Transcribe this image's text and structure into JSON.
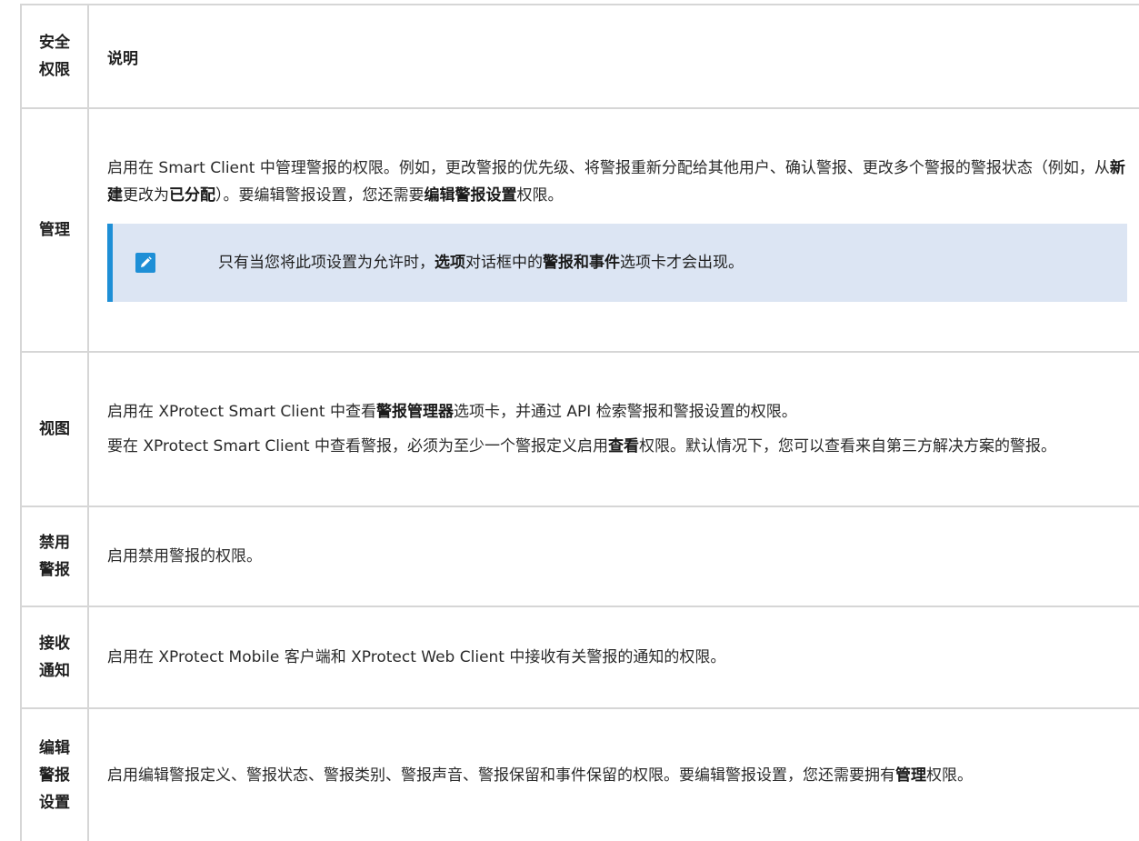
{
  "table": {
    "header": {
      "col1": "安全权限",
      "col1_lines": [
        "安全",
        "权限"
      ],
      "col2": "说明"
    },
    "rows": [
      {
        "name_lines": [
          "管理"
        ],
        "paragraphs": [
          [
            {
              "t": "启用在 Smart Client 中管理警报的权限。例如，更改警报的优先级、将警报重新分配给其他用户、确认警报、更改多个警报的警报状态（例如，从",
              "b": false
            },
            {
              "t": "新建",
              "b": true
            },
            {
              "t": "更改为",
              "b": false
            },
            {
              "t": "已分配",
              "b": true
            },
            {
              "t": "）。要编辑警报设置，您还需要",
              "b": false
            },
            {
              "t": "编辑警报设置",
              "b": true
            },
            {
              "t": "权限。",
              "b": false
            }
          ]
        ],
        "note": [
          {
            "t": "只有当您将此项设置为允许时，",
            "b": false
          },
          {
            "t": "选项",
            "b": true
          },
          {
            "t": "对话框中的",
            "b": false
          },
          {
            "t": "警报和事件",
            "b": true
          },
          {
            "t": "选项卡才会出现。",
            "b": false
          }
        ]
      },
      {
        "name_lines": [
          "视图"
        ],
        "paragraphs": [
          [
            {
              "t": "启用在 XProtect Smart Client 中查看",
              "b": false
            },
            {
              "t": "警报管理器",
              "b": true
            },
            {
              "t": "选项卡，并通过 API 检索警报和警报设置的权限。",
              "b": false
            }
          ],
          [
            {
              "t": "要在 XProtect Smart Client 中查看警报，必须为至少一个警报定义启用",
              "b": false
            },
            {
              "t": "查看",
              "b": true
            },
            {
              "t": "权限。默认情况下，您可以查看来自第三方解决方案的警报。",
              "b": false
            }
          ]
        ]
      },
      {
        "name_lines": [
          "禁用",
          "警报"
        ],
        "paragraphs": [
          [
            {
              "t": "启用禁用警报的权限。",
              "b": false
            }
          ]
        ]
      },
      {
        "name_lines": [
          "接收",
          "通知"
        ],
        "paragraphs": [
          [
            {
              "t": "启用在 XProtect Mobile 客户端和 XProtect Web Client 中接收有关警报的通知的权限。",
              "b": false
            }
          ]
        ]
      },
      {
        "name_lines": [
          "编辑",
          "警报",
          "设置"
        ],
        "paragraphs": [
          [
            {
              "t": "启用编辑警报定义、警报状态、警报类别、警报声音、警报保留和事件保留的权限。要编辑警报设置，您还需要拥有",
              "b": false
            },
            {
              "t": "管理",
              "b": true
            },
            {
              "t": "权限。",
              "b": false
            }
          ]
        ]
      }
    ]
  },
  "icons": {
    "note_icon": "pencil-icon"
  },
  "colors": {
    "border": "#d6d6d6",
    "note_background": "#dce5f3",
    "note_accent": "#1e8fd6"
  }
}
